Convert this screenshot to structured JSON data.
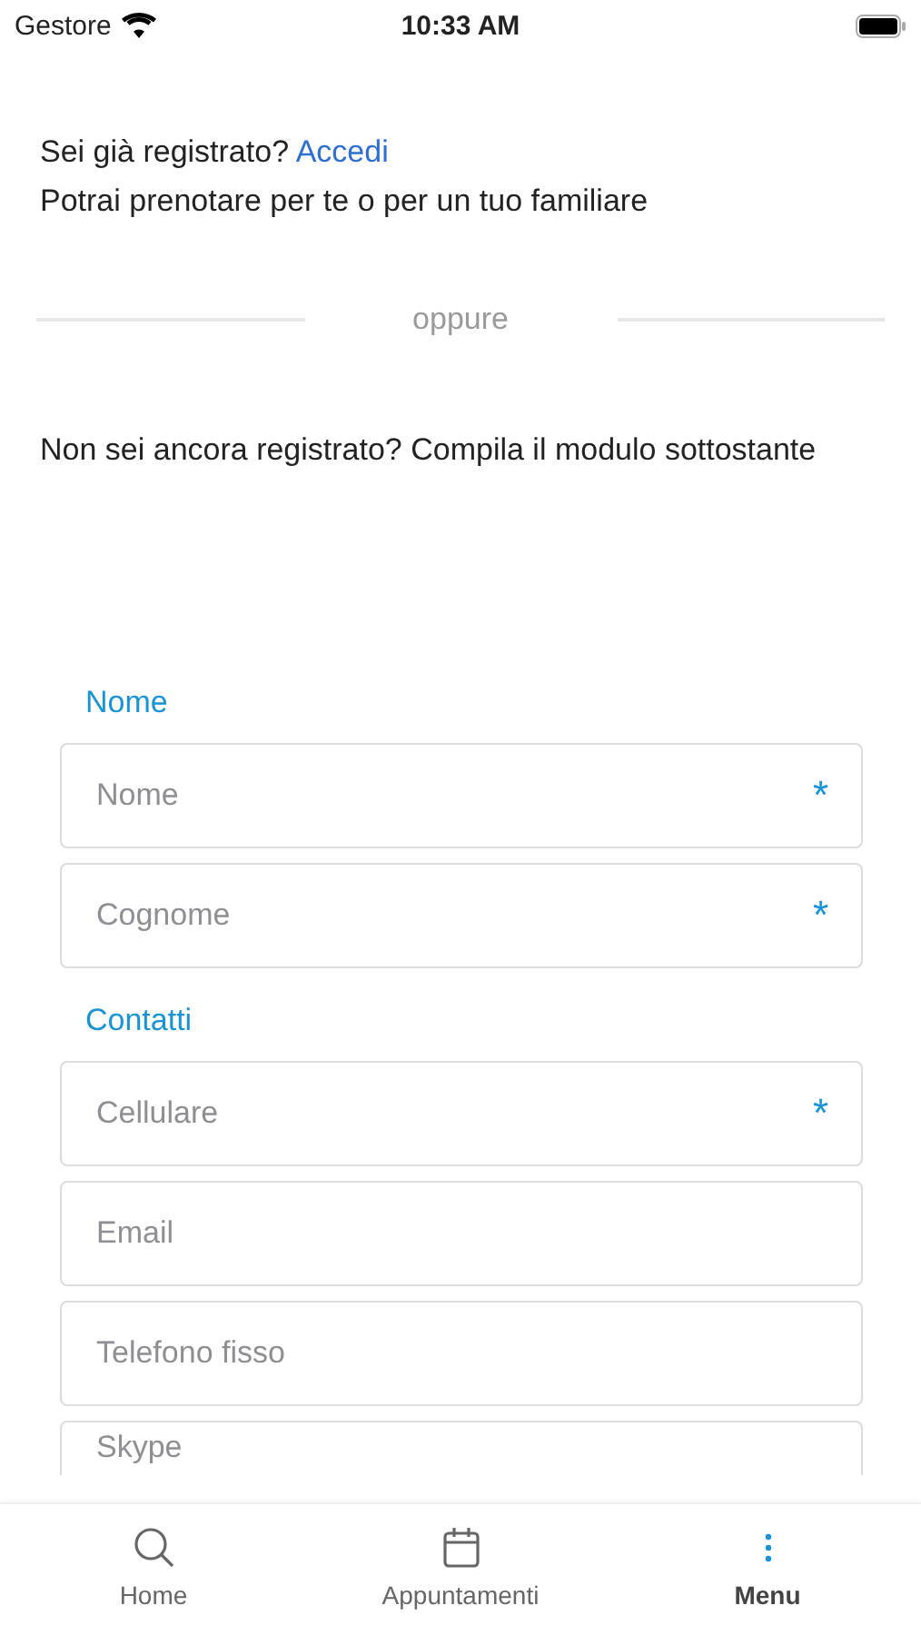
{
  "status_bar": {
    "carrier": "Gestore",
    "time": "10:33 AM"
  },
  "intro": {
    "question": "Sei già registrato?",
    "link": "Accedi",
    "subtitle": "Potrai prenotare per te o per un tuo familiare"
  },
  "divider_label": "oppure",
  "register_prompt": "Non sei ancora registrato? Compila il modulo sottostante",
  "sections": [
    {
      "title": "Nome",
      "fields": [
        {
          "placeholder": "Nome",
          "required_mark": "*"
        },
        {
          "placeholder": "Cognome",
          "required_mark": "*"
        }
      ]
    },
    {
      "title": "Contatti",
      "fields": [
        {
          "placeholder": "Cellulare",
          "required_mark": "*"
        },
        {
          "placeholder": "Email"
        },
        {
          "placeholder": "Telefono fisso"
        },
        {
          "placeholder": "Skype"
        }
      ]
    }
  ],
  "tab_bar": [
    {
      "label": "Home",
      "kind": "search",
      "selected": false
    },
    {
      "label": "Appuntamenti",
      "kind": "calendar",
      "selected": false
    },
    {
      "label": "Menu",
      "kind": "more",
      "selected": true
    }
  ]
}
